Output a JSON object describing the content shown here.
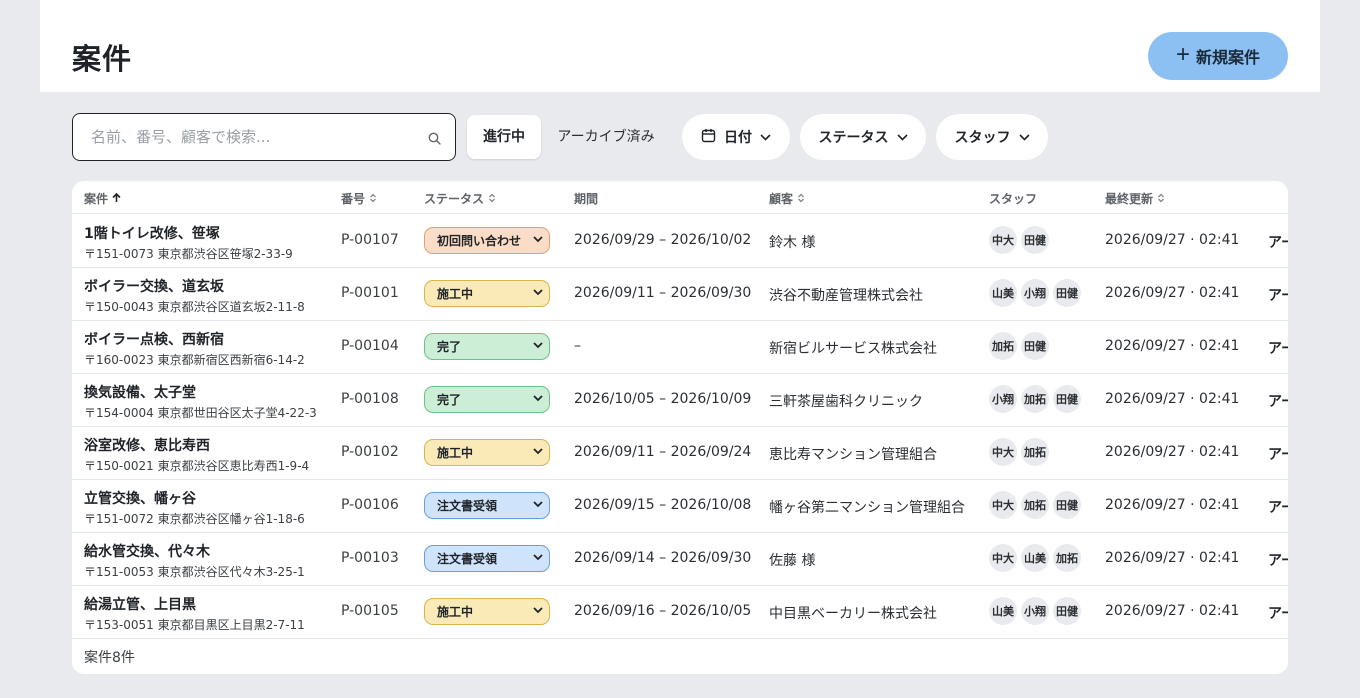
{
  "header": {
    "title": "案件",
    "new_button_label": "新規案件"
  },
  "search": {
    "placeholder": "名前、番号、顧客で検索...",
    "value": ""
  },
  "tabs": {
    "active": "進行中",
    "archive": "アーカイブ済み"
  },
  "filters": {
    "date": "日付",
    "status": "ステータス",
    "staff": "スタッフ"
  },
  "table": {
    "headers": {
      "name": "案件",
      "number": "番号",
      "status": "ステータス",
      "period": "期間",
      "client": "顧客",
      "staff": "スタッフ",
      "updated": "最終更新"
    },
    "rows": [
      {
        "title": "1階トイレ改修、笹塚",
        "address": "〒151-0073 東京都渋谷区笹塚2-33-9",
        "number": "P-00107",
        "status": "初回問い合わせ",
        "status_kind": "inquiry",
        "period": "2026/09/29 – 2026/10/02",
        "client": "鈴木 様",
        "staff": [
          "中大",
          "田健"
        ],
        "updated": "2026/09/27 · 02:41",
        "action": "アー"
      },
      {
        "title": "ボイラー交換、道玄坂",
        "address": "〒150-0043 東京都渋谷区道玄坂2-11-8",
        "number": "P-00101",
        "status": "施工中",
        "status_kind": "inprogress",
        "period": "2026/09/11 – 2026/09/30",
        "client": "渋谷不動産管理株式会社",
        "staff": [
          "山美",
          "小翔",
          "田健"
        ],
        "updated": "2026/09/27 · 02:41",
        "action": "アー"
      },
      {
        "title": "ボイラー点検、西新宿",
        "address": "〒160-0023 東京都新宿区西新宿6-14-2",
        "number": "P-00104",
        "status": "完了",
        "status_kind": "done",
        "period": "–",
        "client": "新宿ビルサービス株式会社",
        "staff": [
          "加拓",
          "田健"
        ],
        "updated": "2026/09/27 · 02:41",
        "action": "アー"
      },
      {
        "title": "換気設備、太子堂",
        "address": "〒154-0004 東京都世田谷区太子堂4-22-3",
        "number": "P-00108",
        "status": "完了",
        "status_kind": "done",
        "period": "2026/10/05 – 2026/10/09",
        "client": "三軒茶屋歯科クリニック",
        "staff": [
          "小翔",
          "加拓",
          "田健"
        ],
        "updated": "2026/09/27 · 02:41",
        "action": "アー"
      },
      {
        "title": "浴室改修、恵比寿西",
        "address": "〒150-0021 東京都渋谷区恵比寿西1-9-4",
        "number": "P-00102",
        "status": "施工中",
        "status_kind": "inprogress",
        "period": "2026/09/11 – 2026/09/24",
        "client": "恵比寿マンション管理組合",
        "staff": [
          "中大",
          "加拓"
        ],
        "updated": "2026/09/27 · 02:41",
        "action": "アー"
      },
      {
        "title": "立管交換、幡ヶ谷",
        "address": "〒151-0072 東京都渋谷区幡ヶ谷1-18-6",
        "number": "P-00106",
        "status": "注文書受領",
        "status_kind": "ordered",
        "period": "2026/09/15 – 2026/10/08",
        "client": "幡ヶ谷第二マンション管理組合",
        "staff": [
          "中大",
          "加拓",
          "田健"
        ],
        "updated": "2026/09/27 · 02:41",
        "action": "アー"
      },
      {
        "title": "給水管交換、代々木",
        "address": "〒151-0053 東京都渋谷区代々木3-25-1",
        "number": "P-00103",
        "status": "注文書受領",
        "status_kind": "ordered",
        "period": "2026/09/14 – 2026/09/30",
        "client": "佐藤 様",
        "staff": [
          "中大",
          "山美",
          "加拓"
        ],
        "updated": "2026/09/27 · 02:41",
        "action": "アー"
      },
      {
        "title": "給湯立管、上目黒",
        "address": "〒153-0051 東京都目黒区上目黒2-7-11",
        "number": "P-00105",
        "status": "施工中",
        "status_kind": "inprogress",
        "period": "2026/09/16 – 2026/10/05",
        "client": "中目黒ベーカリー株式会社",
        "staff": [
          "山美",
          "小翔",
          "田健"
        ],
        "updated": "2026/09/27 · 02:41",
        "action": "アー"
      }
    ],
    "footer": "案件8件"
  },
  "colors": {
    "page_bg": "#e8eaed",
    "primary_button": "#8cc0f2",
    "status": {
      "inquiry": {
        "bg": "#fbdcc6",
        "border": "#e0a070"
      },
      "inprogress": {
        "bg": "#faeab8",
        "border": "#d9b350"
      },
      "done": {
        "bg": "#cdeed6",
        "border": "#6fbf86"
      },
      "ordered": {
        "bg": "#cfe4fb",
        "border": "#6a9fd8"
      }
    }
  },
  "icons": {
    "search": "search-icon",
    "plus": "plus-icon",
    "calendar": "calendar-icon",
    "chevron": "chevron-down-icon",
    "sort": "sort-icon",
    "sort_up": "arrow-up-icon"
  }
}
